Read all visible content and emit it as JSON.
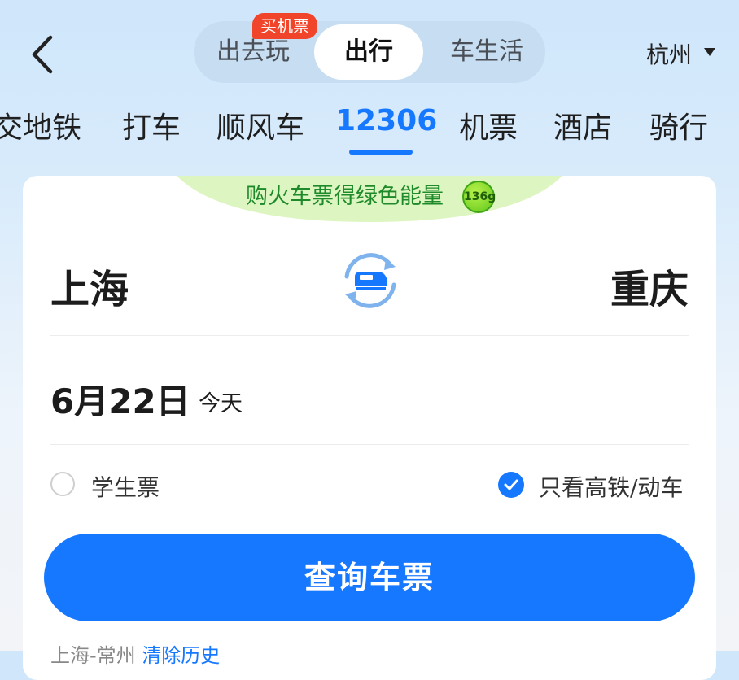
{
  "header": {
    "segments": [
      {
        "label": "出去玩"
      },
      {
        "label": "出行"
      },
      {
        "label": "车生活"
      }
    ],
    "badge": "买机票",
    "city": "杭州"
  },
  "nav": {
    "items": [
      "交地铁",
      "打车",
      "顺风车",
      "12306",
      "机票",
      "酒店",
      "骑行"
    ],
    "active": "12306"
  },
  "promo": {
    "text": "购火车票得绿色能量",
    "energy": "136g"
  },
  "route": {
    "from": "上海",
    "to": "重庆"
  },
  "date": {
    "main": "6月22日",
    "sub": "今天"
  },
  "options": {
    "student": "学生票",
    "high_speed": "只看高铁/动车"
  },
  "search_button": "查询车票",
  "history": {
    "items": "上海-常州",
    "clear": "清除历史"
  },
  "colors": {
    "accent": "#1677ff",
    "badge": "#f0452a",
    "promo_text": "#1e8a2a"
  }
}
